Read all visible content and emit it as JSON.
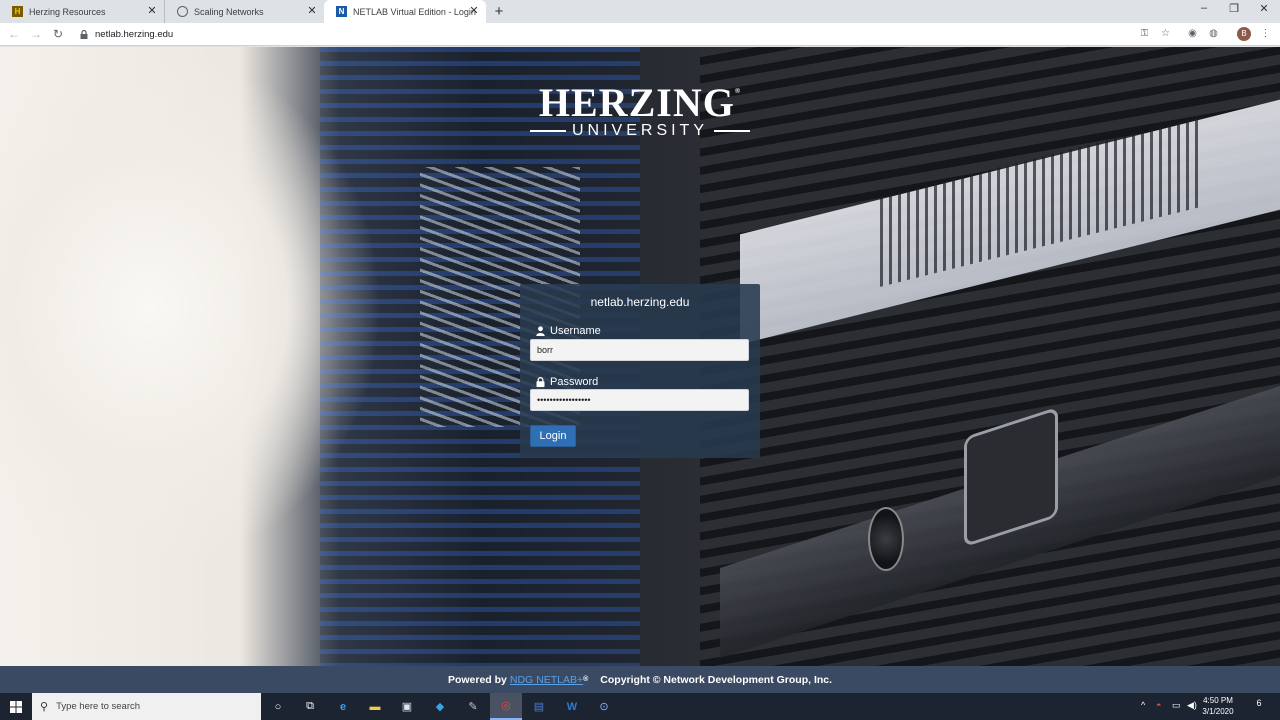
{
  "browser": {
    "tabs": [
      {
        "label": "Herzing Resources",
        "favicon": "herzing-favicon",
        "active": false
      },
      {
        "label": "Scaling Networks",
        "favicon": "globe-icon",
        "active": false
      },
      {
        "label": "NETLAB Virtual Edition - Login",
        "favicon": "netlab-favicon",
        "active": true
      }
    ],
    "new_tab": "+",
    "url": "netlab.herzing.edu",
    "profile_initial": "B"
  },
  "logo": {
    "name": "HERZING",
    "registered": "®",
    "sub": "UNIVERSITY"
  },
  "login": {
    "title": "netlab.herzing.edu",
    "username_label": "Username",
    "username_value": "borr",
    "password_label": "Password",
    "password_value": "•••••••••••••••••",
    "button": "Login"
  },
  "footer": {
    "powered_by": "Powered by",
    "link": "NDG NETLAB+",
    "link_mark": "®",
    "copyright": "Copyright © Network Development Group, Inc."
  },
  "taskbar": {
    "search_placeholder": "Type here to search",
    "time": "4:50 PM",
    "date": "3/1/2020",
    "notification_count": "6"
  }
}
